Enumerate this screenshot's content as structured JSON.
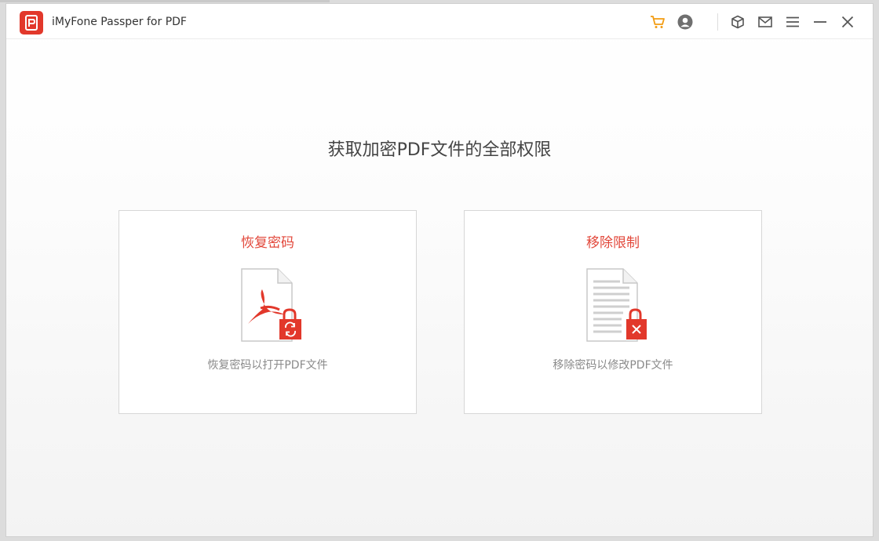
{
  "app": {
    "title": "iMyFone Passper for PDF",
    "brand_color": "#e2382b"
  },
  "titlebar": {
    "icons": [
      "cart-icon",
      "account-icon",
      "box-icon",
      "mail-icon",
      "menu-icon",
      "minimize-icon",
      "close-icon"
    ],
    "cart_color": "#f39c12",
    "icon_color": "#555555"
  },
  "main": {
    "headline": "获取加密PDF文件的全部权限",
    "cards": [
      {
        "title": "恢复密码",
        "description": "恢复密码以打开PDF文件",
        "icon": "pdf-lock-refresh-icon"
      },
      {
        "title": "移除限制",
        "description": "移除密码以修改PDF文件",
        "icon": "doc-lock-remove-icon"
      }
    ],
    "accent": "#e2473a"
  }
}
